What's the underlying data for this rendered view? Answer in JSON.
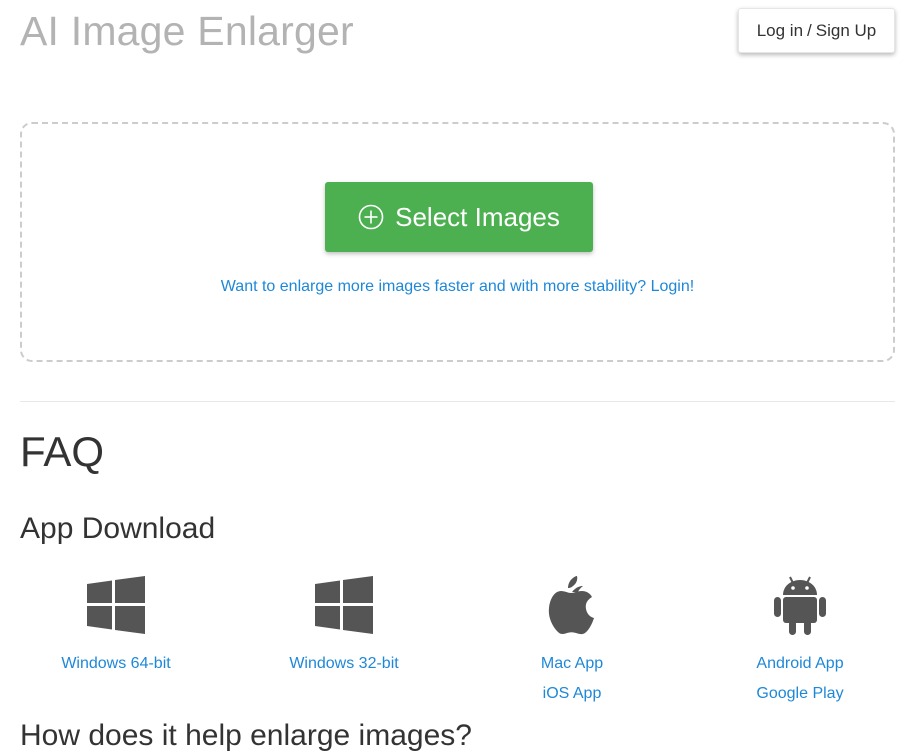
{
  "header": {
    "title": "AI Image Enlarger",
    "login_label": "Log in",
    "separator": "/",
    "signup_label": "Sign Up"
  },
  "upload": {
    "select_label": "Select Images",
    "login_hint": "Want to enlarge more images faster and with more stability? Login!"
  },
  "faq": {
    "title": "FAQ",
    "app_download_title": "App Download",
    "next_heading": "How does it help enlarge images?"
  },
  "downloads": [
    {
      "icon": "windows-icon",
      "links": [
        "Windows 64-bit"
      ]
    },
    {
      "icon": "windows-icon",
      "links": [
        "Windows 32-bit"
      ]
    },
    {
      "icon": "apple-icon",
      "links": [
        "Mac App",
        "iOS App"
      ]
    },
    {
      "icon": "android-icon",
      "links": [
        "Android App",
        "Google Play"
      ]
    }
  ],
  "colors": {
    "accent_green": "#4cb050",
    "link_blue": "#1e88d8",
    "icon_gray": "#555555"
  }
}
